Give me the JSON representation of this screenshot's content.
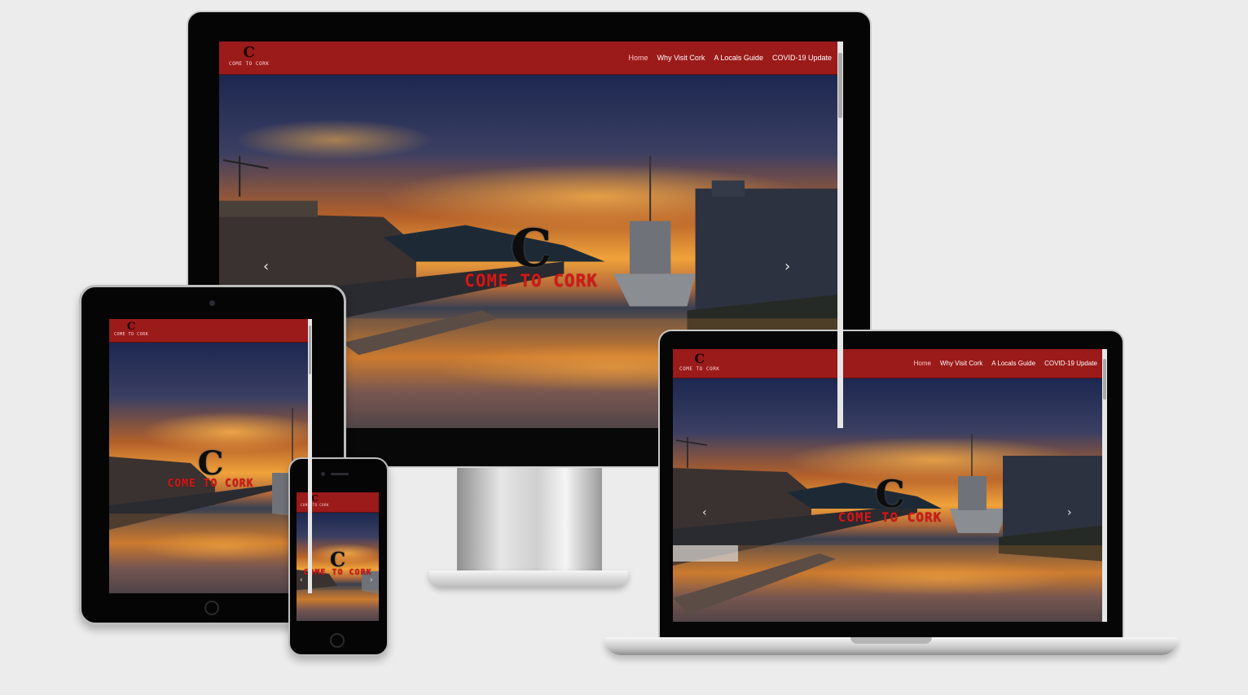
{
  "site": {
    "logo_text": "COME TO CORK",
    "logo_mark": "C",
    "nav": [
      "Home",
      "Why Visit Cork",
      "A Locals Guide",
      "COVID-19 Update"
    ],
    "hero_title": "COME TO CORK",
    "hero_mark": "C",
    "prev_arrow": "‹",
    "next_arrow": "›"
  },
  "colors": {
    "nav_bg": "#9b1a1a",
    "title_red": "#d11a1a",
    "background": "#ececec"
  },
  "icons": {
    "prev": "chevron-left-icon",
    "next": "chevron-right-icon",
    "home_button": "home-button-icon",
    "camera": "camera-icon"
  }
}
